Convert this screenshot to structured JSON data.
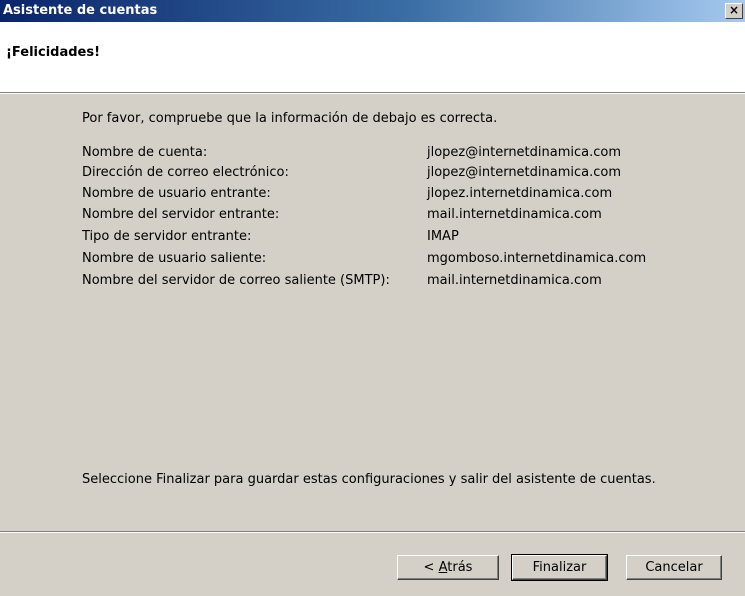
{
  "window": {
    "title": "Asistente de cuentas",
    "close_glyph": "×"
  },
  "header": {
    "heading": "¡Felicidades!"
  },
  "main": {
    "intro": "Por favor, compruebe que la información de debajo es correcta.",
    "rows": [
      {
        "label": "Nombre de cuenta:",
        "value": "jlopez@internetdinamica.com"
      },
      {
        "label": "Dirección de correo electrónico:",
        "value": "jlopez@internetdinamica.com"
      },
      {
        "label": "Nombre de usuario entrante:",
        "value": "jlopez.internetdinamica.com"
      },
      {
        "label": "Nombre del servidor entrante:",
        "value": "mail.internetdinamica.com"
      },
      {
        "label": "Tipo de servidor entrante:",
        "value": "IMAP"
      },
      {
        "label": "Nombre de usuario saliente:",
        "value": "mgomboso.internetdinamica.com"
      },
      {
        "label": "Nombre del servidor de correo saliente (SMTP):",
        "value": "mail.internetdinamica.com"
      }
    ],
    "finish_note": "Seleccione Finalizar para guardar estas configuraciones y salir del asistente de cuentas."
  },
  "buttons": {
    "back_prefix": "< ",
    "back_accel": "A",
    "back_rest": "trás",
    "finish": "Finalizar",
    "cancel": "Cancelar"
  }
}
